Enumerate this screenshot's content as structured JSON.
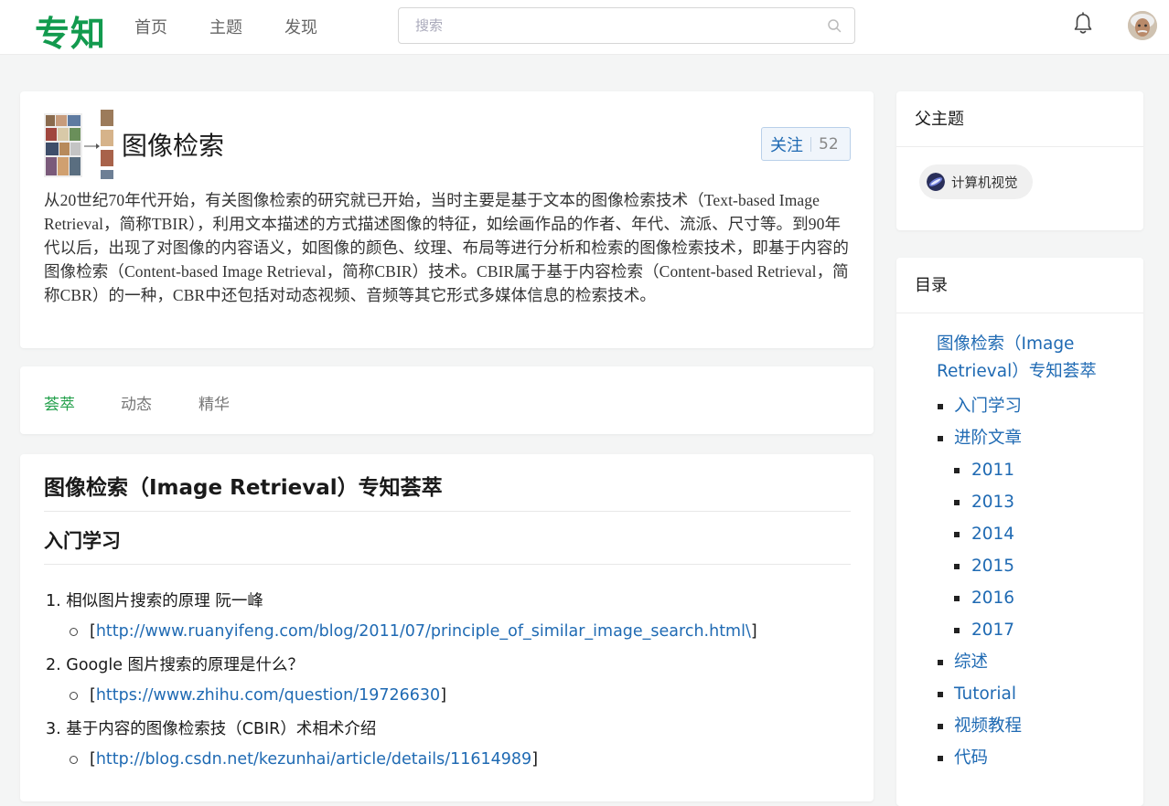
{
  "header": {
    "logo": "专知",
    "nav": [
      "首页",
      "主题",
      "发现"
    ],
    "search_placeholder": "搜索"
  },
  "topic": {
    "title": "图像检索",
    "follow_label": "关注",
    "follow_count": "52",
    "description": "从20世纪70年代开始，有关图像检索的研究就已开始，当时主要是基于文本的图像检索技术（Text-based Image Retrieval，简称TBIR），利用文本描述的方式描述图像的特征，如绘画作品的作者、年代、流派、尺寸等。到90年代以后，出现了对图像的内容语义，如图像的颜色、纹理、布局等进行分析和检索的图像检索技术，即基于内容的图像检索（Content-based Image Retrieval，简称CBIR）技术。CBIR属于基于内容检索（Content-based Retrieval，简称CBR）的一种，CBR中还包括对动态视频、音频等其它形式多媒体信息的检索技术。"
  },
  "tabs": [
    "荟萃",
    "动态",
    "精华"
  ],
  "active_tab": 0,
  "content": {
    "h1": "图像检索（Image Retrieval）专知荟萃",
    "h2": "入门学习",
    "items": [
      {
        "num": "1.",
        "title": "相似图片搜索的原理 阮一峰",
        "link": "http://www.ruanyifeng.com/blog/2011/07/principle_of_similar_image_search.html\\"
      },
      {
        "num": "2.",
        "title": "Google 图片搜索的原理是什么？",
        "link": "https://www.zhihu.com/question/19726630"
      },
      {
        "num": "3.",
        "title": "基于内容的图像检索技（CBIR）术相术介绍",
        "link": "http://blog.csdn.net/kezunhai/article/details/11614989"
      }
    ]
  },
  "parent": {
    "title": "父主题",
    "chip": "计算机视觉"
  },
  "toc": {
    "title": "目录",
    "top": "图像检索（Image Retrieval）专知荟萃",
    "items": [
      {
        "label": "入门学习",
        "level": 1
      },
      {
        "label": "进阶文章",
        "level": 1
      },
      {
        "label": "2011",
        "level": 2
      },
      {
        "label": "2013",
        "level": 2
      },
      {
        "label": "2014",
        "level": 2
      },
      {
        "label": "2015",
        "level": 2
      },
      {
        "label": "2016",
        "level": 2
      },
      {
        "label": "2017",
        "level": 2
      },
      {
        "label": "综述",
        "level": 1
      },
      {
        "label": "Tutorial",
        "level": 1
      },
      {
        "label": "视频教程",
        "level": 1
      },
      {
        "label": "代码",
        "level": 1
      }
    ]
  },
  "colors": {
    "brand": "#129a4e",
    "link": "#1f6ab3",
    "tab_active": "#23a04b"
  }
}
